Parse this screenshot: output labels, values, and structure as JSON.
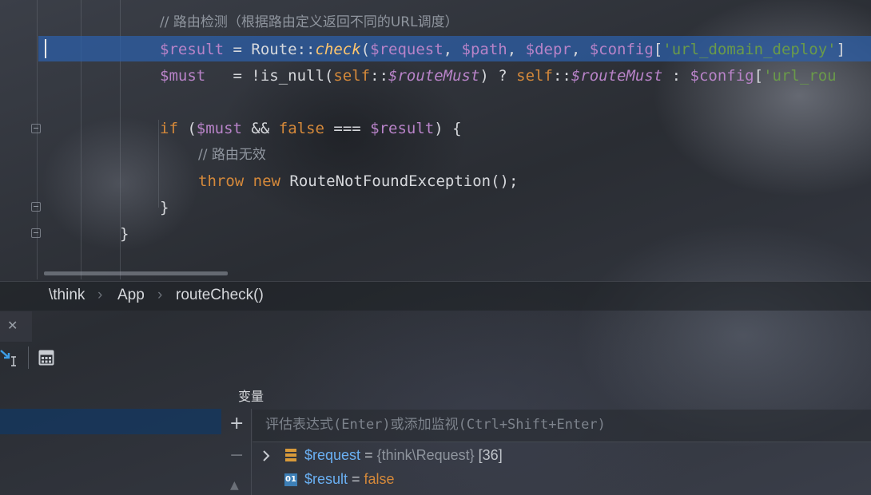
{
  "editor": {
    "comment": "// 路由检测（根据路由定义返回不同的URL调度）",
    "line1": {
      "var": "$result",
      "eq": " = Route::",
      "method": "check",
      "open": "(",
      "a1": "$request",
      "c1": ", ",
      "a2": "$path",
      "c2": ", ",
      "a3": "$depr",
      "c3": ", ",
      "a4": "$config",
      "br": "[",
      "key": "'url_domain_deploy'",
      "tail": "]"
    },
    "line2": {
      "var": "$must",
      "eq": "   = !is_null(",
      "self1": "self",
      "dc1": "::",
      "prop1": "$routeMust",
      "q": ") ? ",
      "self2": "self",
      "dc2": "::",
      "prop2": "$routeMust",
      "colon": " : ",
      "cfg": "$config",
      "br": "[",
      "key": "'url_rou"
    },
    "line3": {
      "if": "if",
      "p1": " (",
      "must": "$must",
      "and": " && ",
      "false": "false",
      "eq3": " === ",
      "result": "$result",
      "p2": ") {"
    },
    "comment2": "// 路由无效",
    "line4": {
      "throw": "throw",
      "new": "new",
      "cls": " RouteNotFoundException();"
    },
    "close1": "}",
    "close2": "}"
  },
  "breadcrumb": [
    "\\think",
    "App",
    "routeCheck()"
  ],
  "debugger": {
    "variables_title": "变量",
    "eval_placeholder": "评估表达式(Enter)或添加监视(Ctrl+Shift+Enter)",
    "add_symbol": "+",
    "remove_symbol": "−",
    "close_symbol": "✕",
    "variables": [
      {
        "name": "$request",
        "eq": " = ",
        "type": "{think\\Request}",
        "value": " [36]",
        "icon": "object-icon",
        "expandable": true
      },
      {
        "name": "$result",
        "eq": " = ",
        "value": "false",
        "icon": "boolean-icon",
        "icon_text": "01",
        "expandable": false
      }
    ]
  },
  "colors": {
    "highlight": "#2d5faa",
    "variable": "#b883c8",
    "keyword": "#d5893a",
    "method": "#ffc66d",
    "string": "#6a9a4a",
    "debug_var_name": "#6ab0f3"
  }
}
